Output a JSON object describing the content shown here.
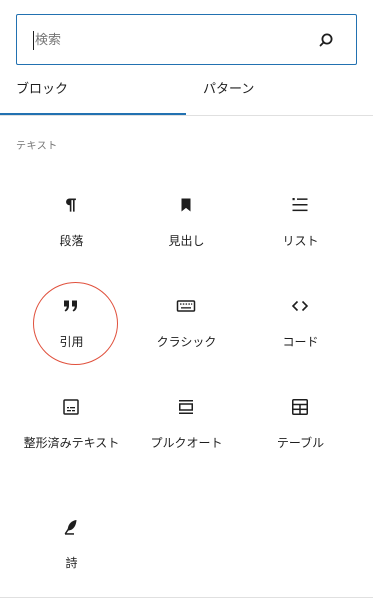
{
  "search": {
    "placeholder": "検索",
    "icon": "search-icon"
  },
  "tabs": [
    {
      "label": "ブロック",
      "active": true
    },
    {
      "label": "パターン",
      "active": false
    }
  ],
  "accent_color": "#2271b1",
  "highlight_color": "#e0503c",
  "category": {
    "label": "テキスト",
    "blocks": [
      {
        "label": "段落",
        "icon": "paragraph-icon"
      },
      {
        "label": "見出し",
        "icon": "heading-bookmark-icon"
      },
      {
        "label": "リスト",
        "icon": "list-icon"
      },
      {
        "label": "引用",
        "icon": "quote-icon",
        "highlighted": true
      },
      {
        "label": "クラシック",
        "icon": "keyboard-icon"
      },
      {
        "label": "コード",
        "icon": "code-icon"
      },
      {
        "label": "整形済みテキスト",
        "icon": "preformatted-icon"
      },
      {
        "label": "プルクオート",
        "icon": "pullquote-icon"
      },
      {
        "label": "テーブル",
        "icon": "table-icon"
      },
      {
        "label": "詩",
        "icon": "verse-feather-icon"
      }
    ]
  }
}
